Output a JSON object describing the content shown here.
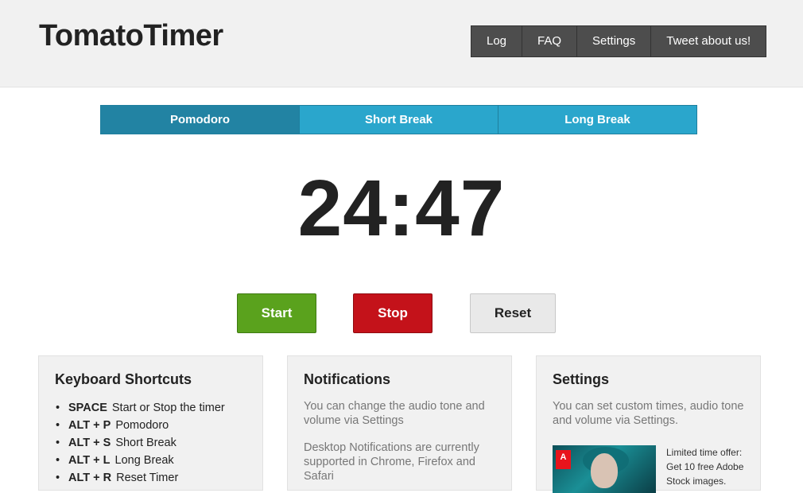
{
  "header": {
    "logo": "TomatoTimer",
    "nav": [
      "Log",
      "FAQ",
      "Settings",
      "Tweet about us!"
    ]
  },
  "tabs": [
    {
      "label": "Pomodoro",
      "active": true
    },
    {
      "label": "Short Break",
      "active": false
    },
    {
      "label": "Long Break",
      "active": false
    }
  ],
  "timer": {
    "display": "24:47"
  },
  "controls": {
    "start_label": "Start",
    "stop_label": "Stop",
    "reset_label": "Reset"
  },
  "colors": {
    "tab_bg": "#2aa6cc",
    "tab_active_bg": "#2283a3",
    "start_bg": "#5aa21d",
    "stop_bg": "#c4121a",
    "reset_bg": "#e9e9e9",
    "nav_bg": "#4d4d4d"
  },
  "panels": {
    "shortcuts": {
      "title": "Keyboard Shortcuts",
      "items": [
        {
          "key": "SPACE",
          "desc": "Start or Stop the timer"
        },
        {
          "key": "ALT + P",
          "desc": "Pomodoro"
        },
        {
          "key": "ALT + S",
          "desc": "Short Break"
        },
        {
          "key": "ALT + L",
          "desc": "Long Break"
        },
        {
          "key": "ALT + R",
          "desc": "Reset Timer"
        }
      ]
    },
    "notifications": {
      "title": "Notifications",
      "text1": "You can change the audio tone and volume via Settings",
      "text2": "Desktop Notifications are currently supported in Chrome, Firefox and Safari"
    },
    "settings": {
      "title": "Settings",
      "text": "You can set custom times, audio tone and volume via Settings.",
      "ad_logo": "A",
      "ad_text": "Limited time offer: Get 10 free Adobe Stock images."
    }
  }
}
